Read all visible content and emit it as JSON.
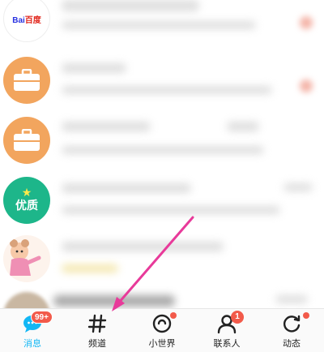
{
  "avatars": {
    "baidu_logo_text": "Bai",
    "baidu_logo_text_cn": "百度",
    "premium_text": "优质"
  },
  "tabbar": {
    "messages": {
      "label": "消息",
      "badge": "99+",
      "icon": "chat-bubble-icon"
    },
    "channels": {
      "label": "频道",
      "icon": "hash-icon"
    },
    "small_world": {
      "label": "小世界",
      "icon": "planet-icon"
    },
    "contacts": {
      "label": "联系人",
      "badge": "1",
      "icon": "person-icon"
    },
    "activity": {
      "label": "动态",
      "icon": "refresh-icon"
    }
  },
  "colors": {
    "accent": "#12b7f5",
    "badge": "#f25a4a",
    "annotation_arrow": "#e83a9a",
    "briefcase_avatar": "#f2a55e",
    "premium_avatar": "#1db68a"
  }
}
